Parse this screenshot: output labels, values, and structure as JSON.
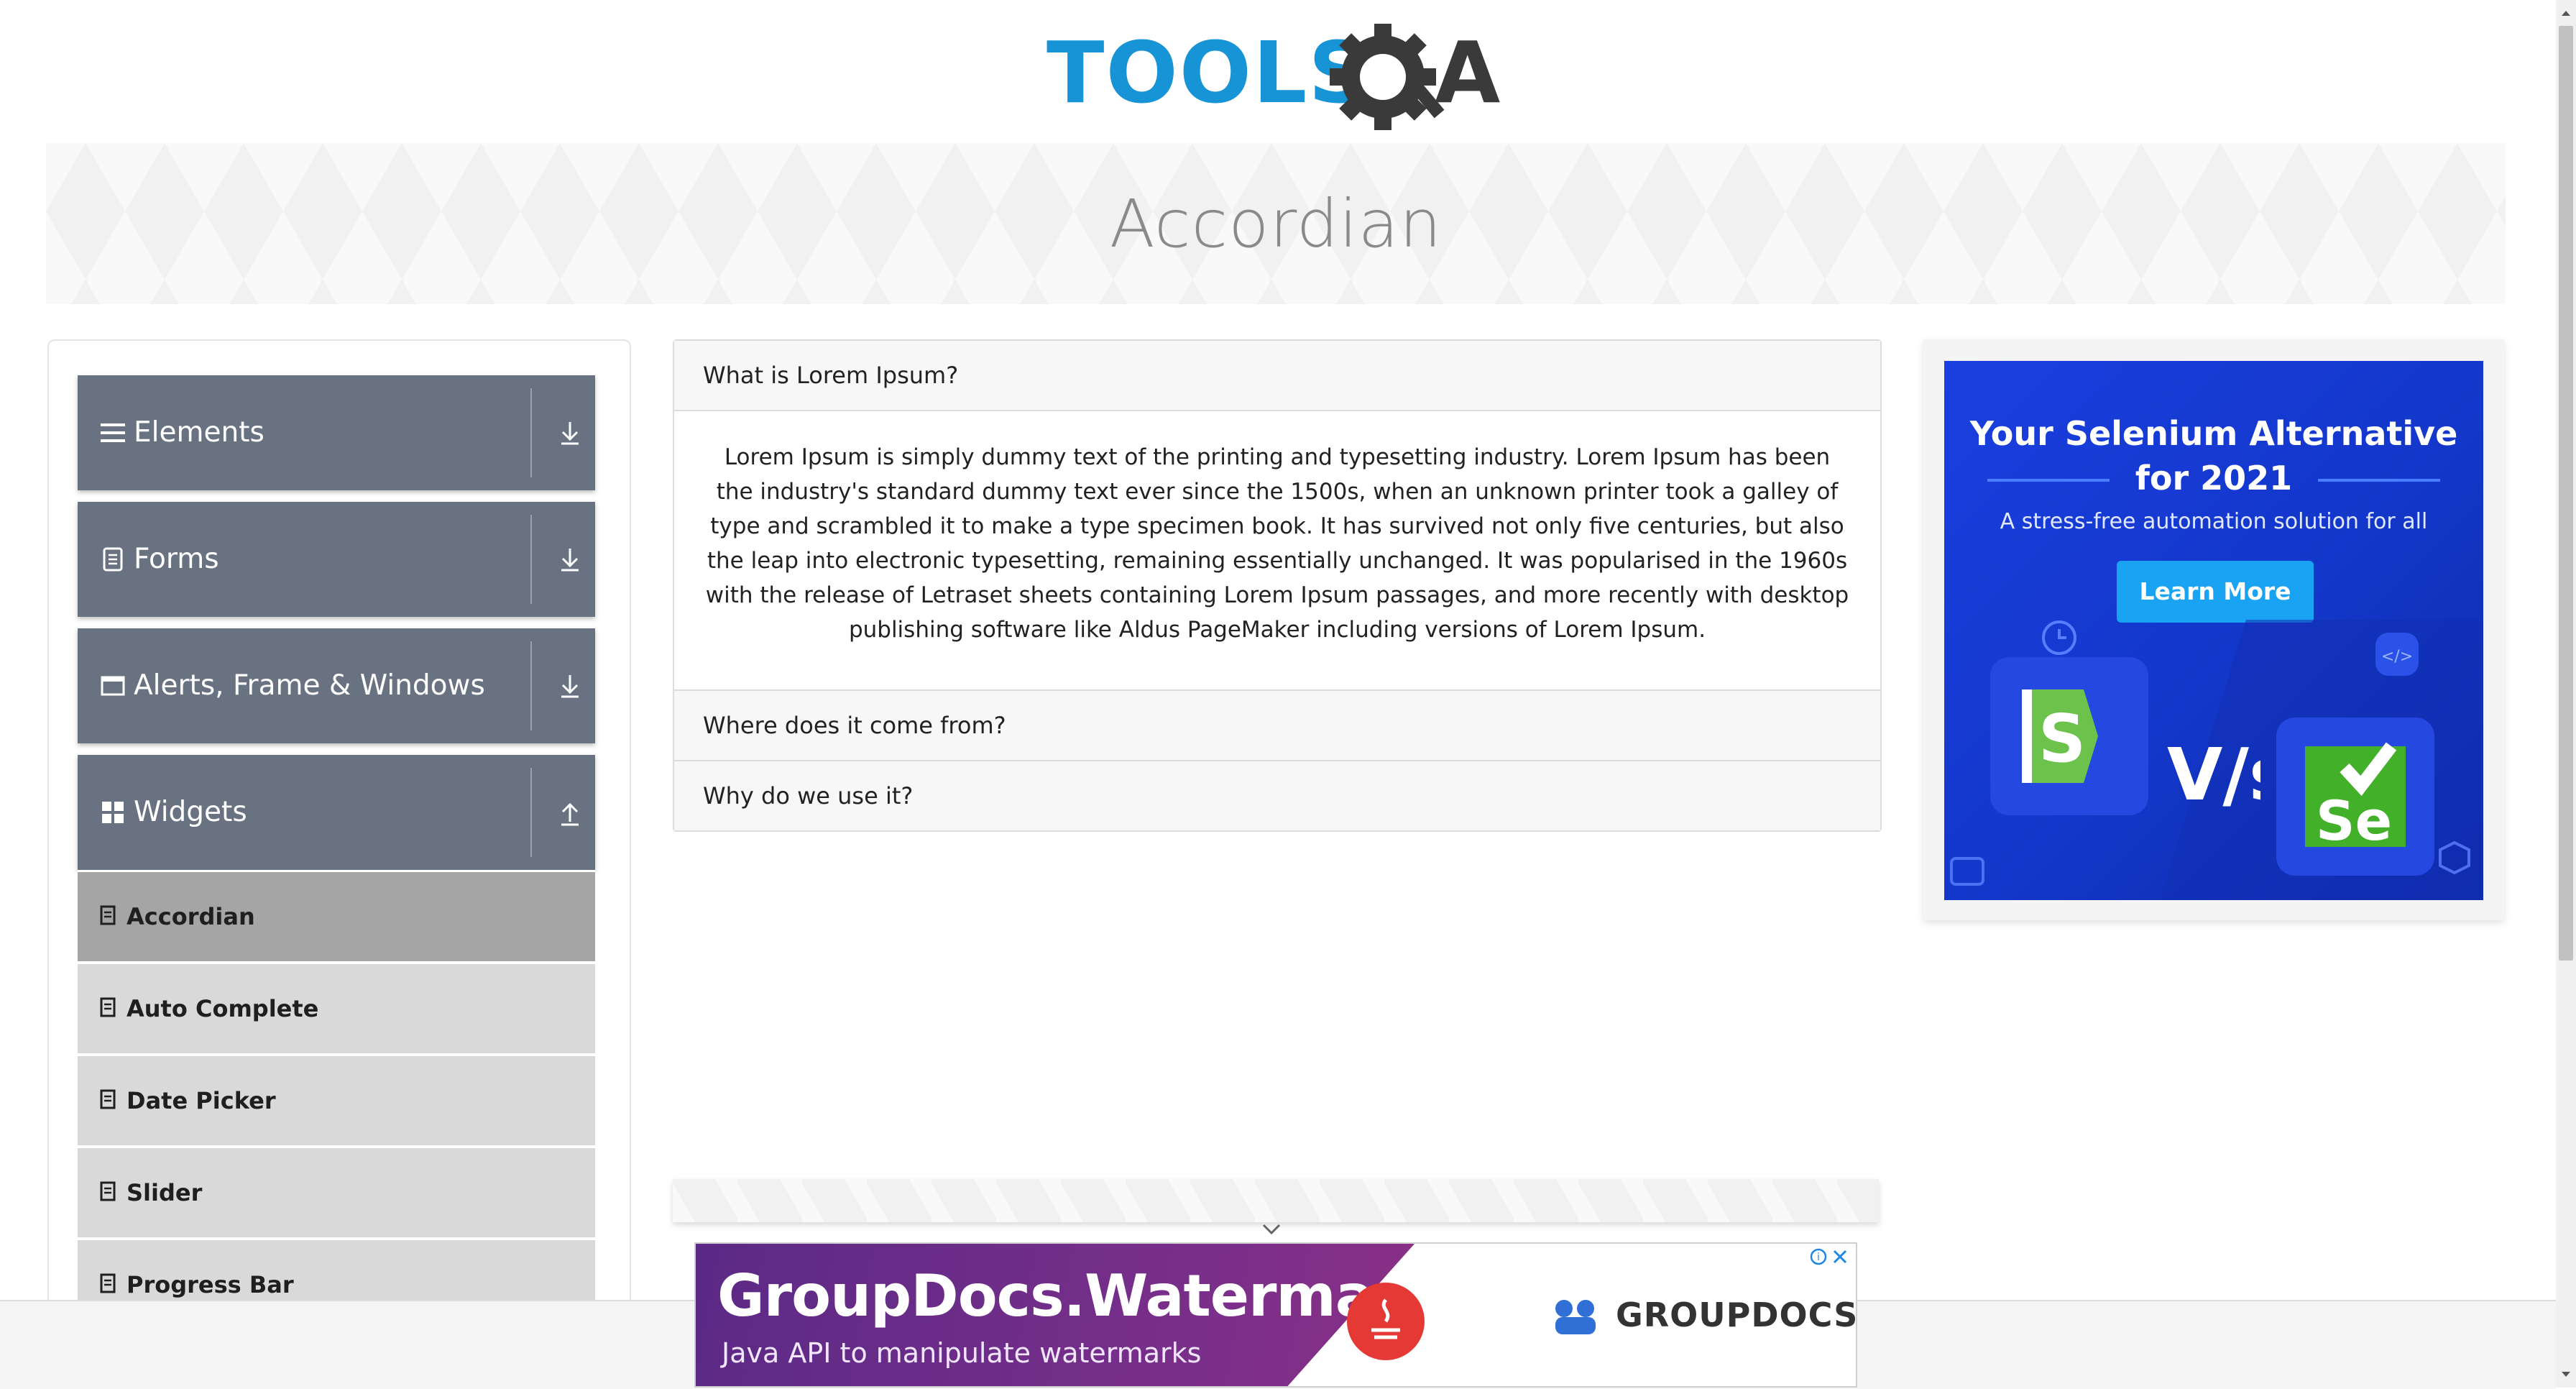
{
  "header": {
    "logo_text_left": "TOOLS",
    "logo_text_right": "A",
    "page_title": "Accordian"
  },
  "sidebar": {
    "groups": [
      {
        "label": "Elements",
        "icon": "hamburger-icon",
        "expanded": false
      },
      {
        "label": "Forms",
        "icon": "document-icon",
        "expanded": false
      },
      {
        "label": "Alerts, Frame & Windows",
        "icon": "window-icon",
        "expanded": false
      },
      {
        "label": "Widgets",
        "icon": "widgets-icon",
        "expanded": true
      }
    ],
    "widget_items": [
      {
        "label": "Accordian",
        "active": true
      },
      {
        "label": "Auto Complete",
        "active": false
      },
      {
        "label": "Date Picker",
        "active": false
      },
      {
        "label": "Slider",
        "active": false
      },
      {
        "label": "Progress Bar",
        "active": false
      }
    ]
  },
  "accordion": {
    "sections": [
      {
        "heading": "What is Lorem Ipsum?",
        "expanded": true,
        "body": "Lorem Ipsum is simply dummy text of the printing and typesetting industry. Lorem Ipsum has been the industry's standard dummy text ever since the 1500s, when an unknown printer took a galley of type and scrambled it to make a type specimen book. It has survived not only five centuries, but also the leap into electronic typesetting, remaining essentially unchanged. It was popularised in the 1960s with the release of Letraset sheets containing Lorem Ipsum passages, and more recently with desktop publishing software like Aldus PageMaker including versions of Lorem Ipsum."
      },
      {
        "heading": "Where does it come from?",
        "expanded": false
      },
      {
        "heading": "Why do we use it?",
        "expanded": false
      }
    ]
  },
  "side_ad": {
    "title": "Your Selenium Alternative for 2021",
    "subtitle": "A stress-free automation solution for all",
    "button_label": "Learn More",
    "vs_text": "V/s",
    "left_logo_letter": "S",
    "right_logo_letters": "Se"
  },
  "bottom_ad": {
    "title": "GroupDocs.Watermark",
    "subtitle": "Java API to manipulate watermarks",
    "brand": "GROUPDOCS"
  },
  "colors": {
    "sidebar_group_bg": "#687281",
    "sidebar_item_bg": "#d9d9d9",
    "sidebar_item_active_bg": "#a5a5a5",
    "logo_blue": "#1794d6",
    "logo_dark": "#3a3a3a",
    "ad_blue": "#1337c9",
    "ad_button": "#1aa3f2",
    "bottom_ad_purple": "#6b2d88"
  }
}
